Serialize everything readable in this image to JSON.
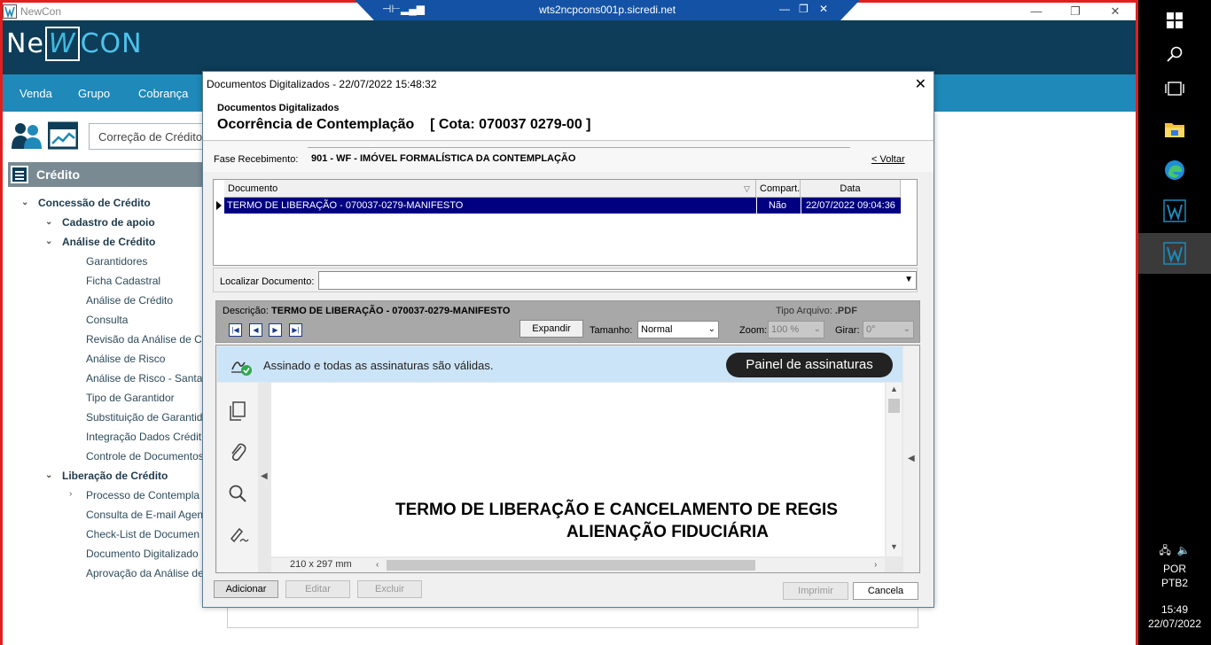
{
  "window": {
    "title": "NewCon",
    "minimize": "—",
    "maximize": "❐",
    "close": "✕"
  },
  "rdp": {
    "host": "wts2ncpcons001p.sicredi.net"
  },
  "brand": {
    "logo_left": "Ne",
    "logo_mark": "W",
    "logo_right": "CON"
  },
  "menu": [
    "Venda",
    "Grupo",
    "Cobrança"
  ],
  "toolbar": {
    "current_item": "Correção de Crédito"
  },
  "sidebar": {
    "title": "Crédito",
    "tree": [
      {
        "label": "Concessão de Crédito",
        "level": 1,
        "bold": true,
        "arrow": "down"
      },
      {
        "label": "Cadastro de apoio",
        "level": 2,
        "bold": true,
        "arrow": "down"
      },
      {
        "label": "Análise de Crédito",
        "level": 2,
        "bold": true,
        "arrow": "down"
      },
      {
        "label": "Garantidores",
        "level": 3
      },
      {
        "label": "Ficha Cadastral",
        "level": 3
      },
      {
        "label": "Análise de Crédito",
        "level": 3
      },
      {
        "label": "Consulta",
        "level": 3
      },
      {
        "label": "Revisão da Análise de C",
        "level": 3
      },
      {
        "label": "Análise de Risco",
        "level": 3
      },
      {
        "label": "Análise de Risco - Santa",
        "level": 3
      },
      {
        "label": "Tipo de Garantidor",
        "level": 3
      },
      {
        "label": "Substituição de Garantid",
        "level": 3
      },
      {
        "label": "Integração Dados Crédit",
        "level": 3
      },
      {
        "label": "Controle de Documentos",
        "level": 3
      },
      {
        "label": "Liberação de Crédito",
        "level": 2,
        "bold": true,
        "arrow": "down"
      },
      {
        "label": "Processo de Contempla",
        "level": 3,
        "arrow": "right"
      },
      {
        "label": "Consulta de E-mail Agen",
        "level": 3
      },
      {
        "label": "Check-List de Documen",
        "level": 3
      },
      {
        "label": "Documento Digitalizado",
        "level": 3
      },
      {
        "label": "Aprovação da Análise de",
        "level": 3
      }
    ]
  },
  "dialog": {
    "title": "Documentos Digitalizados - 22/07/2022  15:48:32",
    "close": "✕",
    "subtitle": "Documentos Digitalizados",
    "heading": "Ocorrência de Contemplação    [ Cota: 070037 0279-00 ]",
    "fase_label": "Fase Recebimento:",
    "fase_value": "901 - WF - IMÓVEL FORMALÍSTICA DA CONTEMPLAÇÃO",
    "back_link": "< Voltar",
    "grid": {
      "columns": [
        "Documento",
        "Compart.",
        "Data"
      ],
      "rows": [
        {
          "documento": "TERMO DE LIBERAÇÃO - 070037-0279-MANIFESTO",
          "compart": "Não",
          "data": "22/07/2022 09:04:36"
        }
      ]
    },
    "localizar_label": "Localizar Documento:",
    "localizar_value": "",
    "viewer": {
      "desc_label": "Descrição:",
      "desc_value": "TERMO DE LIBERAÇÃO - 070037-0279-MANIFESTO",
      "tipo_label": "Tipo Arquivo:",
      "tipo_value": ".PDF",
      "expandir": "Expandir",
      "tamanho_label": "Tamanho:",
      "tamanho_value": "Normal",
      "zoom_label": "Zoom:",
      "zoom_value": "100 %",
      "girar_label": "Girar:",
      "girar_value": "0°"
    },
    "pdf": {
      "signature_text": "Assinado e todas as assinaturas são válidas.",
      "signature_panel_button": "Painel de assinaturas",
      "page_line1": "TERMO DE LIBERAÇÃO E CANCELAMENTO DE REGIS",
      "page_line2": "ALIENAÇÃO FIDUCIÁRIA",
      "page_size": "210 x 297 mm"
    },
    "buttons": {
      "adicionar": "Adicionar",
      "editar": "Editar",
      "excluir": "Excluir",
      "imprimir": "Imprimir",
      "cancela": "Cancela"
    }
  },
  "taskbar": {
    "lang1": "POR",
    "lang2": "PTB2",
    "time": "15:49",
    "date": "22/07/2022"
  }
}
